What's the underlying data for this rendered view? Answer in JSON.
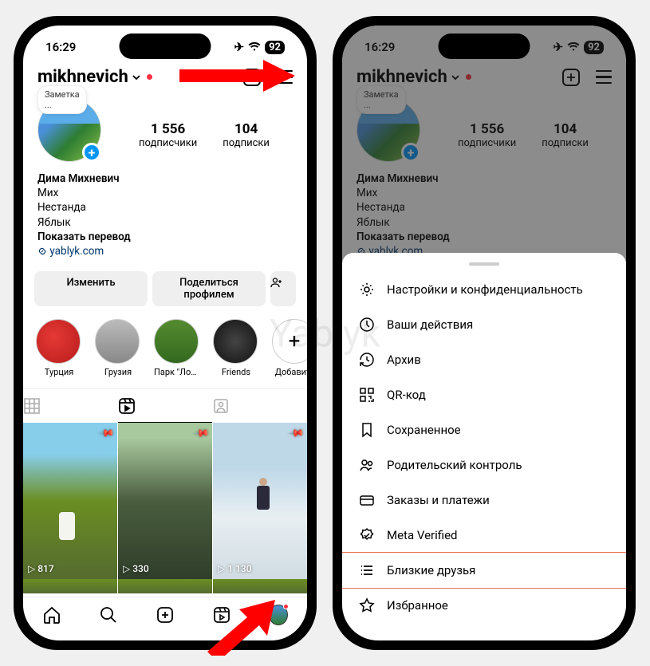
{
  "watermark": "Yablyk",
  "status": {
    "time": "16:29",
    "battery": "92"
  },
  "header": {
    "username": "mikhnevich"
  },
  "note_bubble": "Заметка\n...",
  "stats": {
    "followers_count": "1 556",
    "followers_label": "подписчики",
    "following_count": "104",
    "following_label": "подписки"
  },
  "bio": {
    "name": "Дима Михневич",
    "line1": "Мих",
    "line2": "Нестанда",
    "line3": "Яблык",
    "translate": "Показать перевод",
    "link": "yablyk.com"
  },
  "actions": {
    "edit": "Изменить",
    "share": "Поделиться профилем"
  },
  "highlights": [
    {
      "label": "Турция"
    },
    {
      "label": "Грузия"
    },
    {
      "label": "Парк \"Лога\""
    },
    {
      "label": "Friends"
    },
    {
      "label": "Добавить"
    }
  ],
  "reels": [
    {
      "views": "817"
    },
    {
      "views": "330"
    },
    {
      "views": "1 130"
    }
  ],
  "menu": [
    {
      "label": "Настройки и конфиденциальность"
    },
    {
      "label": "Ваши действия"
    },
    {
      "label": "Архив"
    },
    {
      "label": "QR-код"
    },
    {
      "label": "Сохраненное"
    },
    {
      "label": "Родительский контроль"
    },
    {
      "label": "Заказы и платежи"
    },
    {
      "label": "Meta Verified"
    },
    {
      "label": "Близкие друзья"
    },
    {
      "label": "Избранное"
    }
  ]
}
